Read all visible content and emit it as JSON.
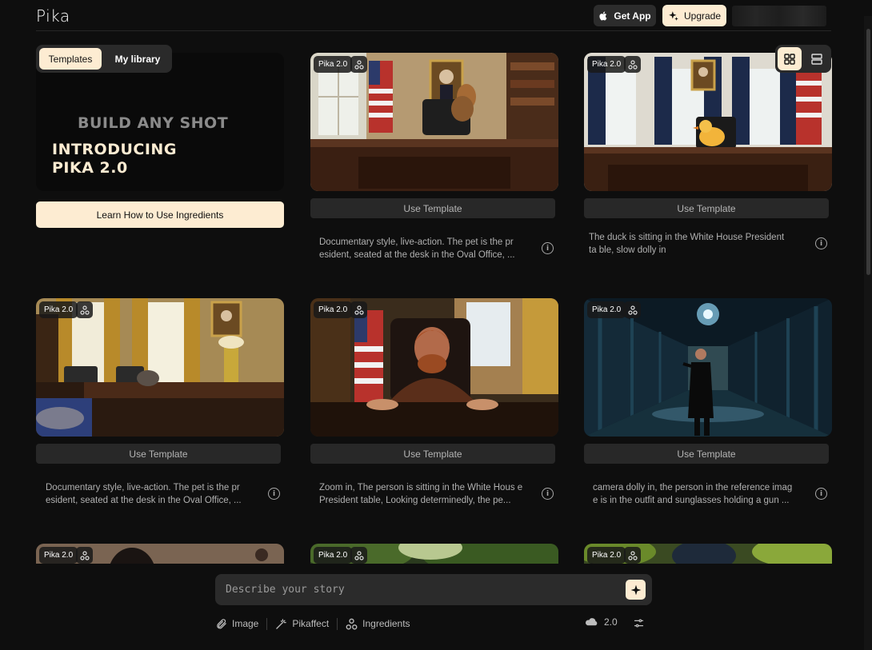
{
  "header": {
    "logo": "Pika",
    "get_app_label": "Get App",
    "upgrade_label": "Upgrade"
  },
  "tabs": [
    {
      "label": "Templates",
      "active": true
    },
    {
      "label": "My library",
      "active": false
    }
  ],
  "hero": {
    "line1": "BUILD ANY SHOT",
    "line2": "INTRODUCING PIKA 2.0",
    "cta_label": "Learn How to Use Ingredients"
  },
  "view_toggle": {
    "active": "grid"
  },
  "cards": [
    {
      "badge": "Pika 2.0",
      "button_label": "Use Template",
      "description": "Documentary style, live-action. The pet is the pr esident, seated at the desk in the Oval Office, ...",
      "scene": "dog-oval-office"
    },
    {
      "badge": "Pika 2.0",
      "button_label": "Use Template",
      "description": "The duck is sitting in the White House President ta ble, slow dolly in",
      "scene": "duck-oval-office"
    },
    {
      "badge": "Pika 2.0",
      "button_label": "Use Template",
      "description": "Documentary style, live-action. The pet is the pr esident, seated at the desk in the Oval Office, ...",
      "scene": "cat-oval-office"
    },
    {
      "badge": "Pika 2.0",
      "button_label": "Use Template",
      "description": "Zoom in, The person is sitting in the White Hous e President table, Looking determinedly, the pe...",
      "scene": "man-at-desk"
    },
    {
      "badge": "Pika 2.0",
      "button_label": "Use Template",
      "description": "camera dolly in, the person in the reference imag e is in the outfit and sunglasses holding a gun ...",
      "scene": "rain-corridor"
    }
  ],
  "peek_cards": [
    {
      "badge": "Pika 2.0"
    },
    {
      "badge": "Pika 2.0"
    },
    {
      "badge": "Pika 2.0"
    }
  ],
  "prompt": {
    "placeholder": "Describe your story"
  },
  "toolbar": {
    "image_label": "Image",
    "pikaffect_label": "Pikaffect",
    "ingredients_label": "Ingredients",
    "model_label": "2.0"
  },
  "colors": {
    "accent": "#fdecd2",
    "background": "#0e0e0e",
    "surface": "#2a2a2a"
  },
  "icons": {
    "apple": "apple-icon",
    "sparkle": "sparkle-icon",
    "ingredients": "ingredients-icon",
    "grid": "grid-view-icon",
    "list": "list-view-icon",
    "info": "info-icon",
    "paperclip": "paperclip-icon",
    "magic_wand": "magic-wand-icon",
    "cloud": "cloud-icon",
    "sliders": "sliders-icon"
  }
}
